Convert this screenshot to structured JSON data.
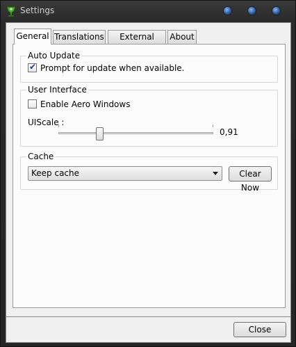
{
  "window": {
    "title": "Settings"
  },
  "tabs": [
    {
      "label": "General",
      "active": true
    },
    {
      "label": "Translations",
      "active": false
    },
    {
      "label": "External Apps",
      "active": false
    },
    {
      "label": "About",
      "active": false
    }
  ],
  "auto_update": {
    "legend": "Auto Update",
    "prompt_label": "Prompt for update when available.",
    "prompt_checked": true
  },
  "user_interface": {
    "legend": "User Interface",
    "aero_label": "Enable Aero Windows",
    "aero_checked": false,
    "uiscale_label": "UIScale :",
    "uiscale_value": "0,91"
  },
  "cache": {
    "legend": "Cache",
    "selected": "Keep cache",
    "clear_label": "Clear Now"
  },
  "footer": {
    "close_label": "Close"
  },
  "colors": {
    "panel": "#f0f0f0",
    "window_chrome": "#2b2b2b",
    "check": "#233a86"
  }
}
